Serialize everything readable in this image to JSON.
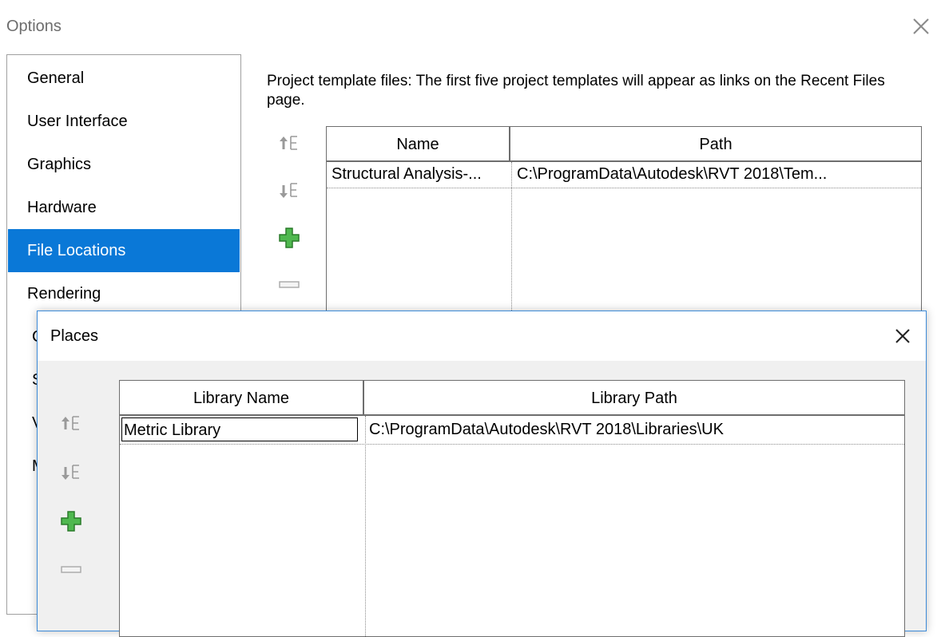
{
  "options": {
    "title": "Options",
    "nav": [
      {
        "label": "General"
      },
      {
        "label": "User Interface"
      },
      {
        "label": "Graphics"
      },
      {
        "label": "Hardware"
      },
      {
        "label": "File Locations",
        "selected": true
      },
      {
        "label": "Rendering"
      },
      {
        "label": "C"
      },
      {
        "label": "S"
      },
      {
        "label": "V"
      },
      {
        "label": "M"
      }
    ],
    "description": "Project template files:  The first five project templates will appear as links on the Recent Files page.",
    "table": {
      "columns": [
        "Name",
        "Path"
      ],
      "rows": [
        {
          "name": "Structural Analysis-...",
          "path": "C:\\ProgramData\\Autodesk\\RVT 2018\\Tem..."
        }
      ]
    }
  },
  "places": {
    "title": "Places",
    "table": {
      "columns": [
        "Library Name",
        "Library Path"
      ],
      "rows": [
        {
          "name": "Metric Library",
          "path": "C:\\ProgramData\\Autodesk\\RVT 2018\\Libraries\\UK"
        }
      ]
    }
  },
  "colors": {
    "selection": "#0a78d7",
    "add_green": "#3aa63a",
    "dialog_border": "#3c8ad8"
  },
  "icons": [
    "close-icon",
    "move-up-icon",
    "move-down-icon",
    "add-icon",
    "remove-icon"
  ]
}
